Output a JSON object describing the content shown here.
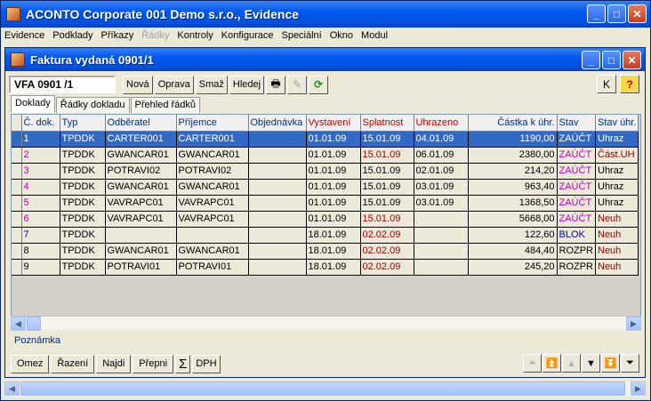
{
  "app": {
    "title": "ACONTO Corporate 001 Demo s.r.o., Evidence"
  },
  "menu": [
    {
      "label": "Evidence",
      "disabled": false
    },
    {
      "label": "Podklady",
      "disabled": false
    },
    {
      "label": "Příkazy",
      "disabled": false
    },
    {
      "label": "Řádky",
      "disabled": true
    },
    {
      "label": "Kontroly",
      "disabled": false
    },
    {
      "label": "Konfigurace",
      "disabled": false
    },
    {
      "label": "Speciální",
      "disabled": false
    },
    {
      "label": "Okno",
      "disabled": false
    },
    {
      "label": "Modul",
      "disabled": false
    }
  ],
  "child": {
    "title": "Faktura vydaná 0901/1"
  },
  "toolbar": {
    "doc_id": "VFA  0901 /1",
    "nova": "Nová",
    "oprava": "Oprava",
    "smaz": "Smaž",
    "hledej": "Hledej",
    "k": "K",
    "help": "?"
  },
  "tabs": [
    "Doklady",
    "Řádky dokladu",
    "Přehled řádků"
  ],
  "grid": {
    "columns": [
      "Č. dok.",
      "Typ",
      "Odběratel",
      "Příjemce",
      "Objednávka",
      "Vystavení",
      "Splatnost",
      "Uhrazeno",
      "Částka k úhr.",
      "Stav",
      "Stav úhr."
    ],
    "rows": [
      {
        "c": [
          "1",
          "TPDDK",
          "CARTER001",
          "CARTER001",
          "",
          "01.01.09",
          "15.01.09",
          "04.01.09",
          "1190,00",
          "ZAÚČT",
          "Uhraz"
        ],
        "nc": "#ff40ff",
        "sc": "#ff40ff",
        "uc": "#ffffff",
        "selected": true
      },
      {
        "c": [
          "2",
          "TPDDK",
          "GWANCAR01",
          "GWANCAR01",
          "",
          "01.01.09",
          "15.01.09",
          "06.01.09",
          "2380,00",
          "ZAÚČT",
          "Část.UH"
        ],
        "nc": "#c000c0",
        "sc": "#c000c0",
        "uc": "#8b0000",
        "spc": "#a00000"
      },
      {
        "c": [
          "3",
          "TPDDK",
          "POTRAVI02",
          "POTRAVI02",
          "",
          "01.01.09",
          "15.01.09",
          "02.01.09",
          "214,20",
          "ZAÚČT",
          "Uhraz"
        ],
        "nc": "#c000c0",
        "sc": "#c000c0",
        "uc": "#000000"
      },
      {
        "c": [
          "4",
          "TPDDK",
          "GWANCAR01",
          "GWANCAR01",
          "",
          "01.01.09",
          "15.01.09",
          "03.01.09",
          "963,40",
          "ZAÚČT",
          "Uhraz"
        ],
        "nc": "#c000c0",
        "sc": "#c000c0",
        "uc": "#000000"
      },
      {
        "c": [
          "5",
          "TPDDK",
          "VAVRAPC01",
          "VAVRAPC01",
          "",
          "01.01.09",
          "15.01.09",
          "03.01.09",
          "1368,50",
          "ZAÚČT",
          "Uhraz"
        ],
        "nc": "#c000c0",
        "sc": "#c000c0",
        "uc": "#000000"
      },
      {
        "c": [
          "6",
          "TPDDK",
          "VAVRAPC01",
          "VAVRAPC01",
          "",
          "01.01.09",
          "15.01.09",
          "",
          "5668,00",
          "ZAÚČT",
          "Neuh"
        ],
        "nc": "#c000c0",
        "sc": "#c000c0",
        "uc": "#a00000",
        "spc": "#a00000"
      },
      {
        "c": [
          "7",
          "TPDDK",
          "",
          "",
          "",
          "18.01.09",
          "02.02.09",
          "",
          "122,60",
          "BLOK",
          "Neuh"
        ],
        "nc": "#0000c0",
        "sc": "#0000c0",
        "uc": "#a00000",
        "spc": "#a00000"
      },
      {
        "c": [
          "8",
          "TPDDK",
          "GWANCAR01",
          "GWANCAR01",
          "",
          "18.01.09",
          "02.02.09",
          "",
          "484,40",
          "ROZPR",
          "Neuh"
        ],
        "nc": "#000000",
        "sc": "#000000",
        "uc": "#a00000",
        "spc": "#a00000"
      },
      {
        "c": [
          "9",
          "TPDDK",
          "POTRAVI01",
          "POTRAVI01",
          "",
          "18.01.09",
          "02.02.09",
          "",
          "245,20",
          "ROZPR",
          "Neuh"
        ],
        "nc": "#000000",
        "sc": "#000000",
        "uc": "#a00000",
        "spc": "#a00000"
      }
    ]
  },
  "poznamka": "Poznámka",
  "bottom": {
    "omez": "Omez",
    "razeni": "Řazení",
    "najdi": "Najdi",
    "prepni": "Přepni",
    "sigma": "Σ",
    "dph": "DPH"
  },
  "colors": {
    "title_blue": "#0054e3",
    "selection": "#316ac5",
    "header_red": "#c00000",
    "header_blue": "#002a8a"
  }
}
